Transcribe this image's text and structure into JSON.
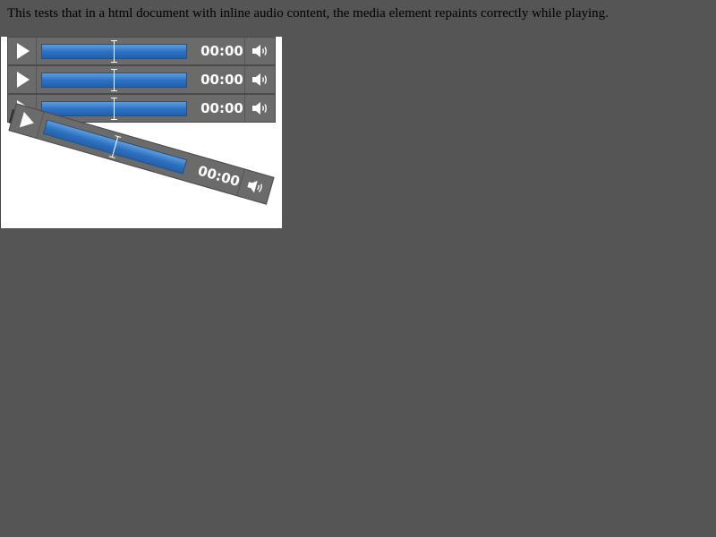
{
  "description": "This tests that in a html document with inline audio content, the media element repaints correctly while playing.",
  "players": [
    {
      "time": "00:00",
      "progress": 0.5
    },
    {
      "time": "00:00",
      "progress": 0.5
    },
    {
      "time": "00:00",
      "progress": 0.5
    },
    {
      "time": "00:00",
      "progress": 0.5
    }
  ],
  "icons": {
    "play": "play-icon",
    "volume": "speaker-icon"
  },
  "colors": {
    "page_bg": "#555555",
    "controls_bg": "#6b6b6b",
    "track_blue": "#2c6fbf"
  }
}
